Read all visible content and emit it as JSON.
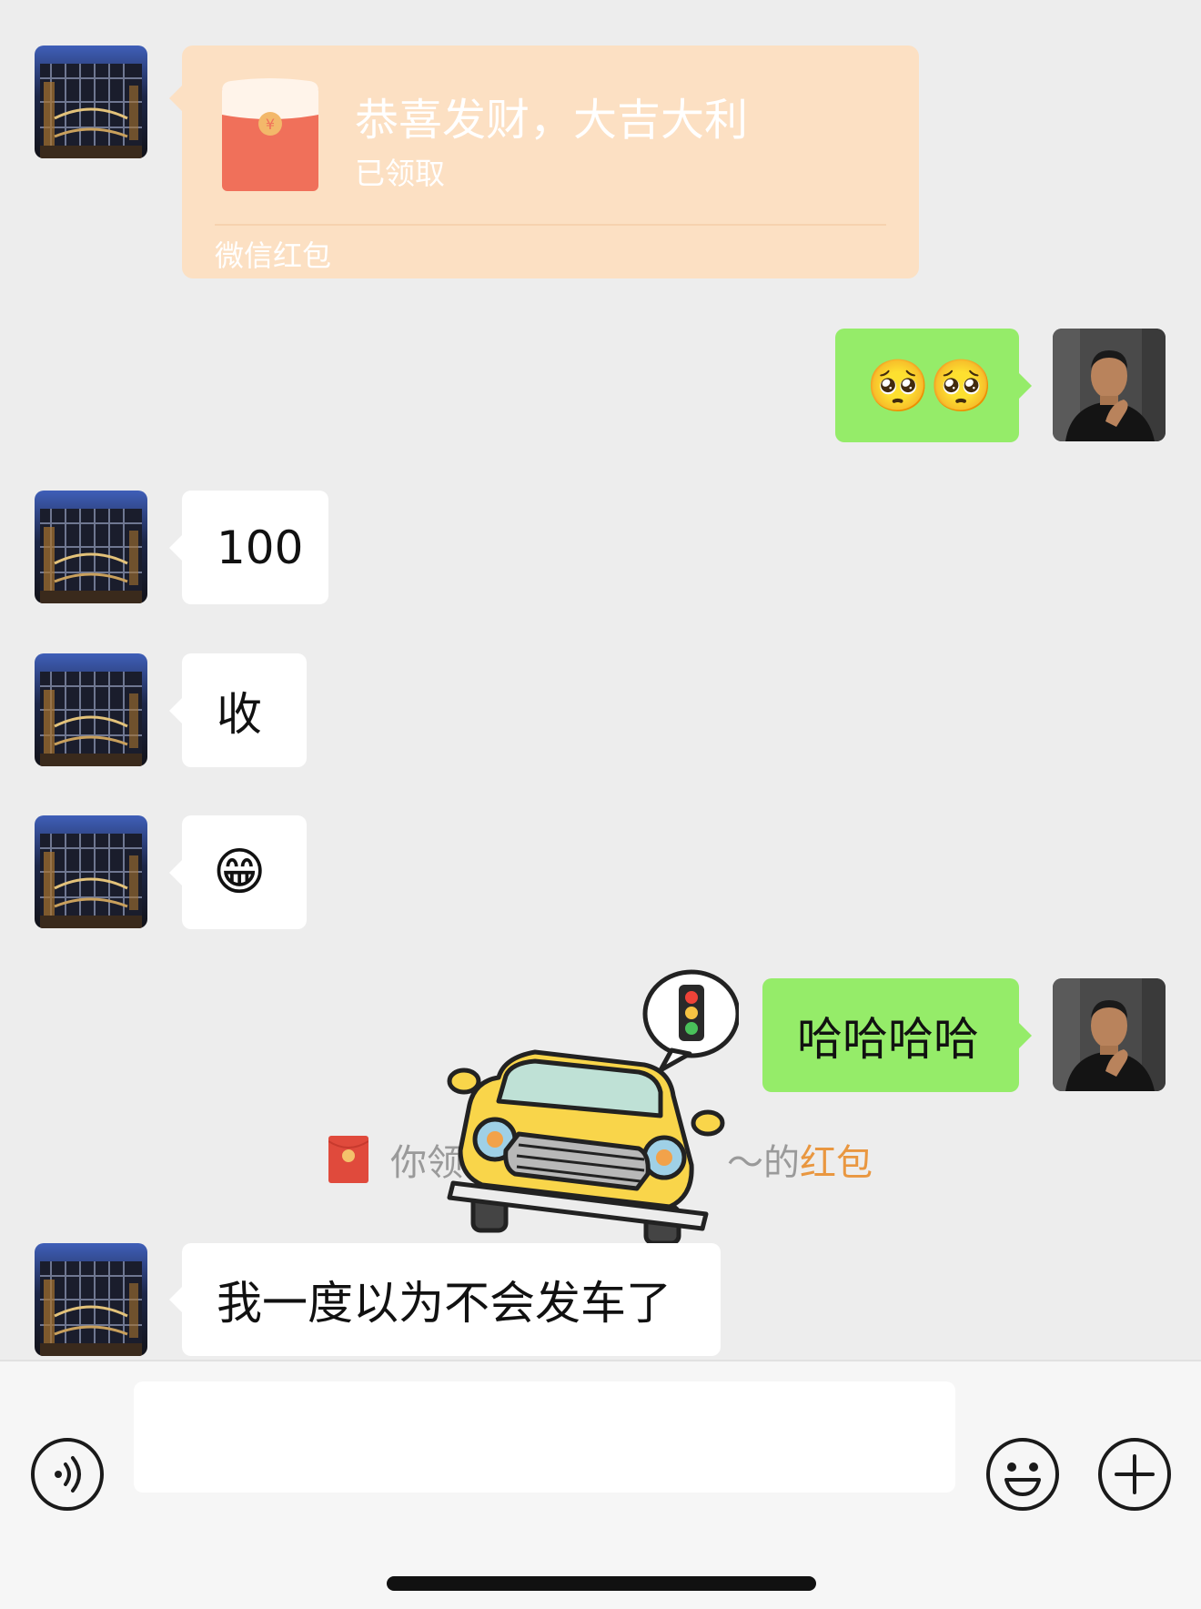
{
  "colors": {
    "background": "#ededed",
    "green_bubble": "#95ec69",
    "white_bubble": "#ffffff",
    "red_packet": "#fce0c3",
    "link_orange": "#e99740"
  },
  "messages": [
    {
      "side": "left",
      "type": "red_packet",
      "title": "恭喜发财，大吉大利",
      "status": "已领取",
      "footer": "微信红包"
    },
    {
      "side": "right",
      "type": "emoji",
      "emojis": [
        "🥺",
        "🥺"
      ]
    },
    {
      "side": "left",
      "type": "text",
      "text": "100"
    },
    {
      "side": "left",
      "type": "text",
      "text": "收"
    },
    {
      "side": "left",
      "type": "emoji",
      "emojis": [
        "😁"
      ]
    },
    {
      "side": "right",
      "type": "text",
      "text": "哈哈哈哈"
    },
    {
      "type": "system",
      "prefix": "你领",
      "suffix": "～的",
      "link": "红包"
    },
    {
      "side": "left",
      "type": "text",
      "text": "我一度以为不会发车了"
    }
  ],
  "sticker": {
    "icon": "car-traffic-light-sticker"
  },
  "input_bar": {
    "placeholder": "",
    "voice_icon": "voice-icon",
    "emoji_icon": "smiley-icon",
    "plus_icon": "plus-icon"
  }
}
